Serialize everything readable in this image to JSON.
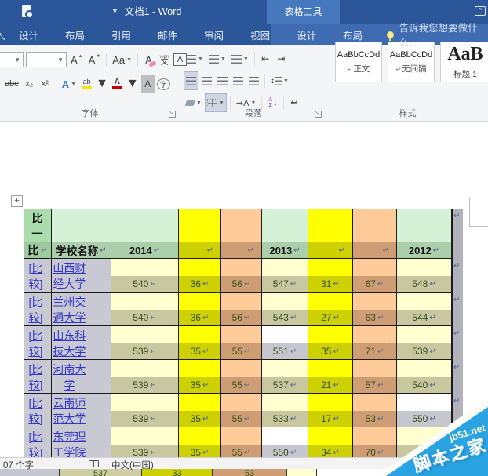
{
  "window": {
    "title": "文档1 - Word",
    "context_group": "表格工具",
    "tell_me": "告诉我您想要做什么...",
    "tab_fragment": "入"
  },
  "tabs": [
    "设计",
    "布局",
    "引用",
    "邮件",
    "审阅",
    "视图"
  ],
  "context_tabs": [
    "设计",
    "布局"
  ],
  "ribbon": {
    "groups": {
      "font": "字体",
      "paragraph": "段落",
      "styles": "样式"
    },
    "styles": [
      {
        "preview": "AaBbCcDd",
        "label": "正文"
      },
      {
        "preview": "AaBbCcDd",
        "label": "无间隔"
      },
      {
        "preview": "AaB",
        "label": "标题 1"
      }
    ]
  },
  "table": {
    "corner": "比一比",
    "school_header": "学校名称",
    "years": [
      "2014",
      "2013",
      "2012"
    ],
    "link_label": "[比较]",
    "rows": [
      {
        "school": "山西财经大学",
        "cells": [
          {
            "v": "540",
            "c": "cream"
          },
          {
            "v": "36",
            "c": "yellow"
          },
          {
            "v": "56",
            "c": "orange"
          },
          {
            "v": "547",
            "c": "cream"
          },
          {
            "v": "31",
            "c": "yellow"
          },
          {
            "v": "67",
            "c": "orange"
          },
          {
            "v": "548",
            "c": "cream"
          }
        ]
      },
      {
        "school": "兰州交通大学",
        "cells": [
          {
            "v": "540",
            "c": "cream"
          },
          {
            "v": "36",
            "c": "yellow"
          },
          {
            "v": "56",
            "c": "orange"
          },
          {
            "v": "543",
            "c": "cream"
          },
          {
            "v": "27",
            "c": "yellow"
          },
          {
            "v": "63",
            "c": "orange"
          },
          {
            "v": "544",
            "c": "cream"
          }
        ]
      },
      {
        "school": "山东科技大学",
        "cells": [
          {
            "v": "539",
            "c": "cream"
          },
          {
            "v": "35",
            "c": "yellow"
          },
          {
            "v": "55",
            "c": "orange"
          },
          {
            "v": "551",
            "c": "white"
          },
          {
            "v": "35",
            "c": "yellow"
          },
          {
            "v": "71",
            "c": "orange"
          },
          {
            "v": "539",
            "c": "cream"
          }
        ]
      },
      {
        "school": "河南大学",
        "cells": [
          {
            "v": "539",
            "c": "cream"
          },
          {
            "v": "35",
            "c": "yellow"
          },
          {
            "v": "55",
            "c": "orange"
          },
          {
            "v": "537",
            "c": "cream"
          },
          {
            "v": "21",
            "c": "yellow"
          },
          {
            "v": "57",
            "c": "orange"
          },
          {
            "v": "540",
            "c": "cream"
          }
        ]
      },
      {
        "school": "云南师范大学",
        "cells": [
          {
            "v": "539",
            "c": "cream"
          },
          {
            "v": "35",
            "c": "yellow"
          },
          {
            "v": "55",
            "c": "orange"
          },
          {
            "v": "533",
            "c": "cream"
          },
          {
            "v": "17",
            "c": "yellow"
          },
          {
            "v": "53",
            "c": "orange"
          },
          {
            "v": "550",
            "c": "white"
          }
        ]
      },
      {
        "school": "东莞理工学院",
        "cells": [
          {
            "v": "539",
            "c": "cream"
          },
          {
            "v": "35",
            "c": "yellow"
          },
          {
            "v": "55",
            "c": "orange"
          },
          {
            "v": "550",
            "c": "white"
          },
          {
            "v": "34",
            "c": "yellow"
          },
          {
            "v": "70",
            "c": "orange"
          },
          {
            "v": "",
            "c": "cream"
          }
        ]
      }
    ]
  },
  "status": {
    "words": "07 个字",
    "language": "中文(中国)"
  },
  "partial_row": {
    "values": [
      "537",
      "33",
      "53"
    ]
  },
  "watermark": {
    "site": "jb51.net",
    "name": "脚本之家"
  },
  "colors": {
    "titlebar": "#2b579a",
    "context_tab": "#4678bd",
    "tab_light": "#3e6bb2",
    "cream": "#ffffcf",
    "yellow": "#ffff00",
    "orange": "#ffcc99",
    "header_green": "#abdcab",
    "selection_gray": "#c9c9d4",
    "watermark_blue": "#2aa3e3"
  }
}
